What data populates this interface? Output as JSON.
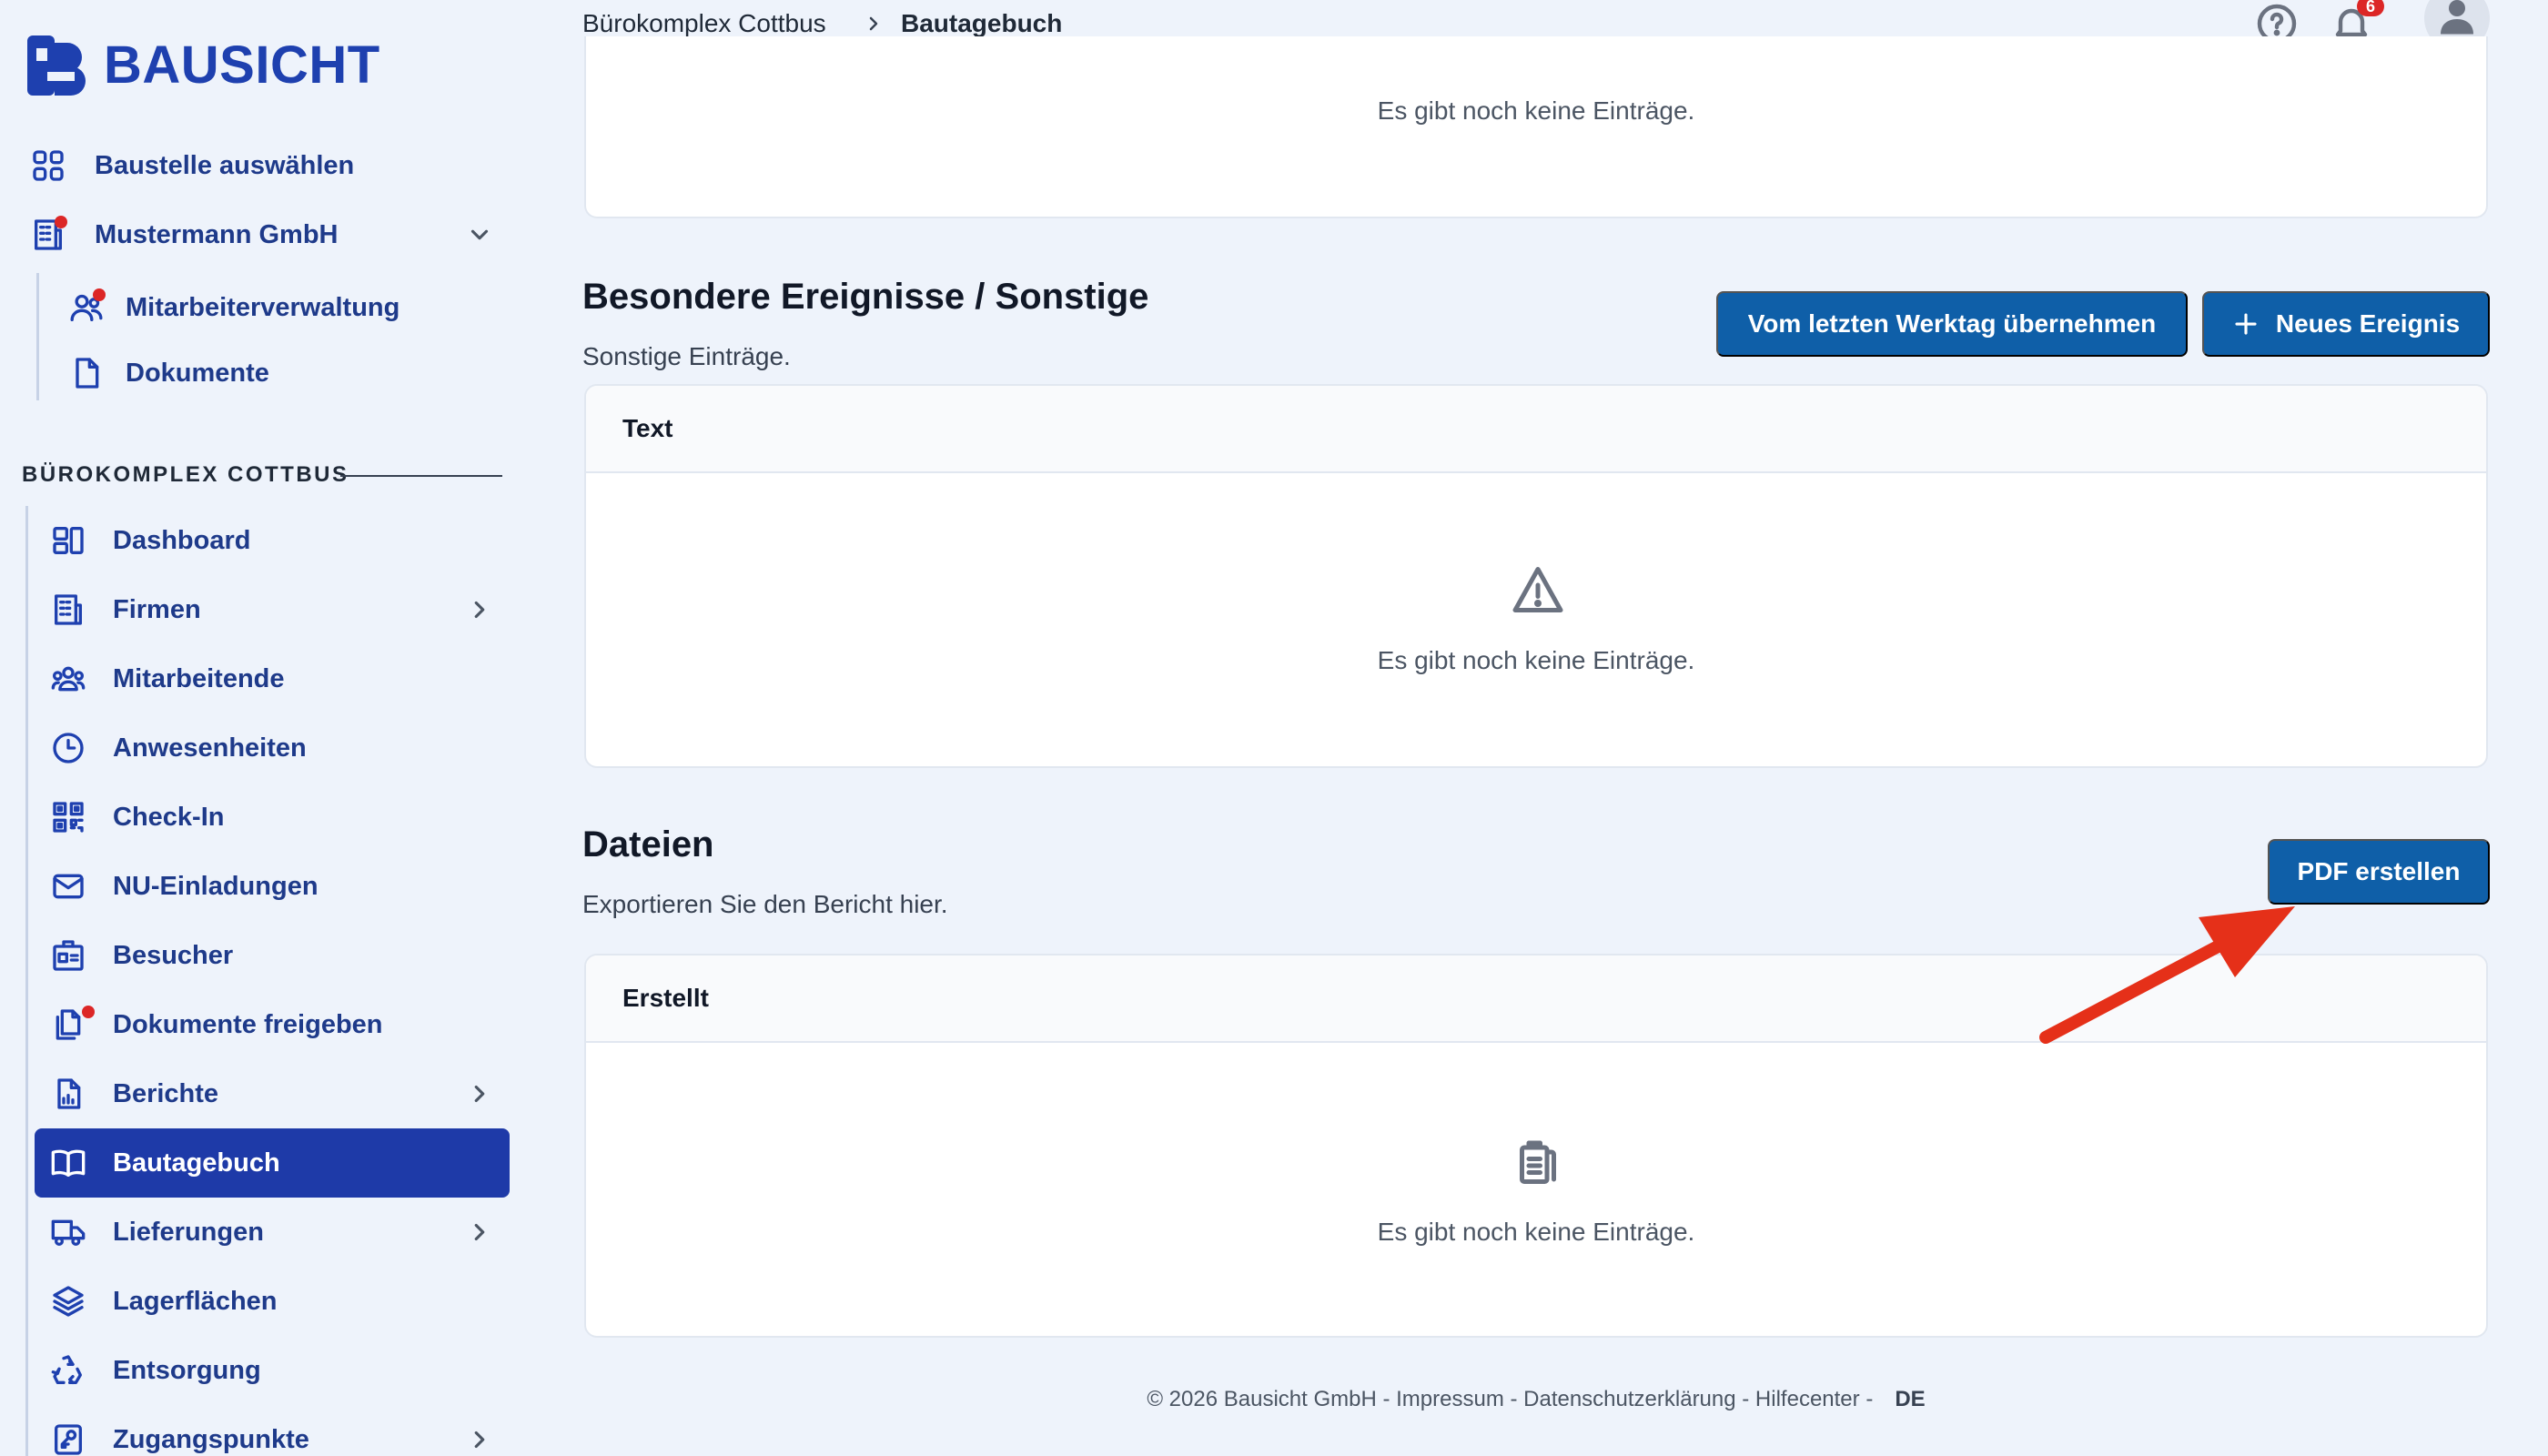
{
  "brand": {
    "name": "BAUSICHT",
    "color": "#1e40af"
  },
  "sidebar": {
    "top_items": [
      {
        "label": "Baustelle auswählen",
        "icon": "grid-icon"
      },
      {
        "label": "Mustermann GmbH",
        "icon": "building-icon",
        "dot": true,
        "expandable": true
      },
      {
        "label": "Mitarbeiterverwaltung",
        "icon": "users-icon",
        "dot": true
      },
      {
        "label": "Dokumente",
        "icon": "document-icon"
      }
    ],
    "section_title": "BÜROKOMPLEX COTTBUS",
    "items": [
      {
        "label": "Dashboard",
        "icon": "dashboard-icon"
      },
      {
        "label": "Firmen",
        "icon": "building-icon",
        "expandable": true
      },
      {
        "label": "Mitarbeitende",
        "icon": "team-icon"
      },
      {
        "label": "Anwesenheiten",
        "icon": "clock-icon"
      },
      {
        "label": "Check-In",
        "icon": "qr-code-icon"
      },
      {
        "label": "NU-Einladungen",
        "icon": "mail-icon"
      },
      {
        "label": "Besucher",
        "icon": "id-card-icon"
      },
      {
        "label": "Dokumente freigeben",
        "icon": "documents-icon",
        "dot": true
      },
      {
        "label": "Berichte",
        "icon": "report-icon",
        "expandable": true
      },
      {
        "label": "Bautagebuch",
        "icon": "book-icon",
        "active": true
      },
      {
        "label": "Lieferungen",
        "icon": "truck-icon",
        "expandable": true
      },
      {
        "label": "Lagerflächen",
        "icon": "layers-icon"
      },
      {
        "label": "Entsorgung",
        "icon": "recycle-icon"
      },
      {
        "label": "Zugangspunkte",
        "icon": "key-icon",
        "expandable": true
      }
    ]
  },
  "breadcrumb": {
    "parent": "Bürokomplex Cottbus",
    "current": "Bautagebuch"
  },
  "topbar": {
    "notification_count": "6"
  },
  "top_card": {
    "empty_text": "Es gibt noch keine Einträge."
  },
  "events": {
    "title": "Besondere Ereignisse / Sonstige",
    "description": "Sonstige Einträge.",
    "copy_button": "Vom letzten Werktag übernehmen",
    "new_button": "Neues Ereignis",
    "column": "Text",
    "empty_text": "Es gibt noch keine Einträge."
  },
  "files": {
    "title": "Dateien",
    "description": "Exportieren Sie den Bericht hier.",
    "pdf_button": "PDF erstellen",
    "column": "Erstellt",
    "empty_text": "Es gibt noch keine Einträge."
  },
  "footer": {
    "text": "© 2026 Bausicht GmbH - Impressum - Datenschutzerklärung - Hilfecenter -",
    "lang": "DE"
  },
  "colors": {
    "button": "#0f5fa8",
    "active_nav": "#1e3aa8",
    "badge": "#dc2626",
    "annotation_arrow": "#e53019"
  }
}
